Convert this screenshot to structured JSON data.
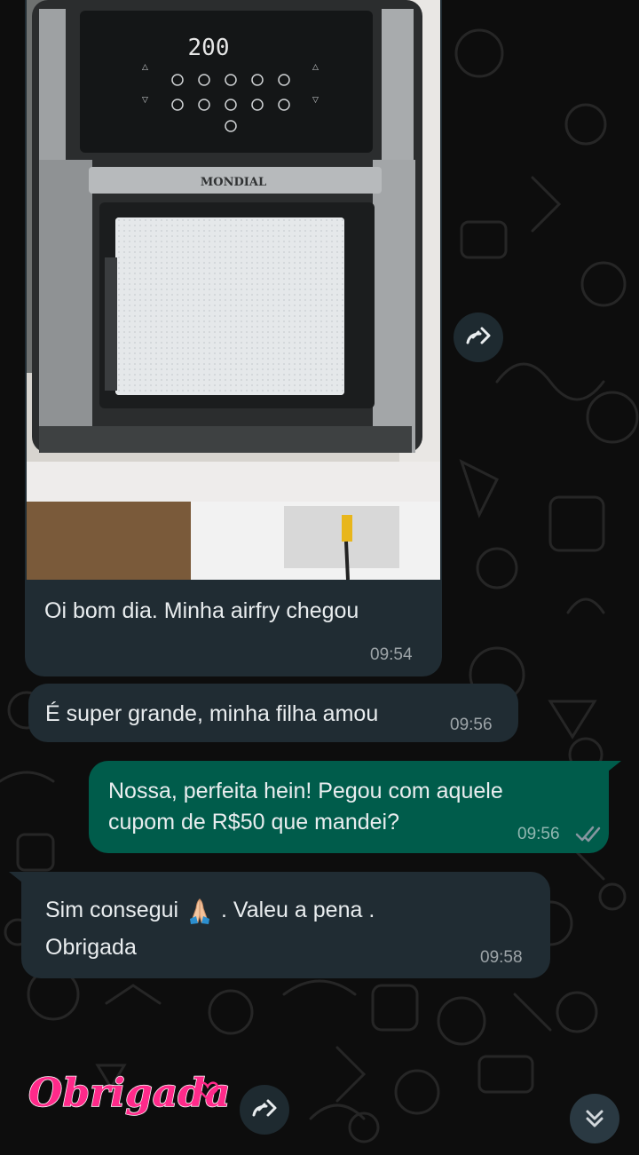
{
  "photo": {
    "oven_display": "200",
    "brand": "MONDIAL"
  },
  "messages": [
    {
      "id": "m1",
      "direction": "in",
      "type": "image",
      "caption": "Oi bom dia. Minha airfry chegou",
      "time": "09:54"
    },
    {
      "id": "m2",
      "direction": "in",
      "text": "É super grande, minha filha amou",
      "time": "09:56"
    },
    {
      "id": "m3",
      "direction": "out",
      "line1": "Nossa, perfeita hein! Pegou com aquele",
      "line2": "cupom de R$50 que mandei?",
      "time": "09:56",
      "status": "read"
    },
    {
      "id": "m4",
      "direction": "in",
      "line1_a": "Sim consegui",
      "line1_b": ". Valeu a pena .",
      "line2": "Obrigada",
      "emoji": "folded-hands",
      "time": "09:58"
    }
  ],
  "sticker": {
    "text": "Obrigada",
    "color": "#ff2a8a"
  },
  "colors": {
    "incoming": "#202c33",
    "outgoing": "#005c4b",
    "background": "#0d0d0d",
    "read_ticks": "#8696a0"
  },
  "icons": {
    "forward": "forward-arrow-icon",
    "scroll_down": "double-chevron-down-icon"
  }
}
